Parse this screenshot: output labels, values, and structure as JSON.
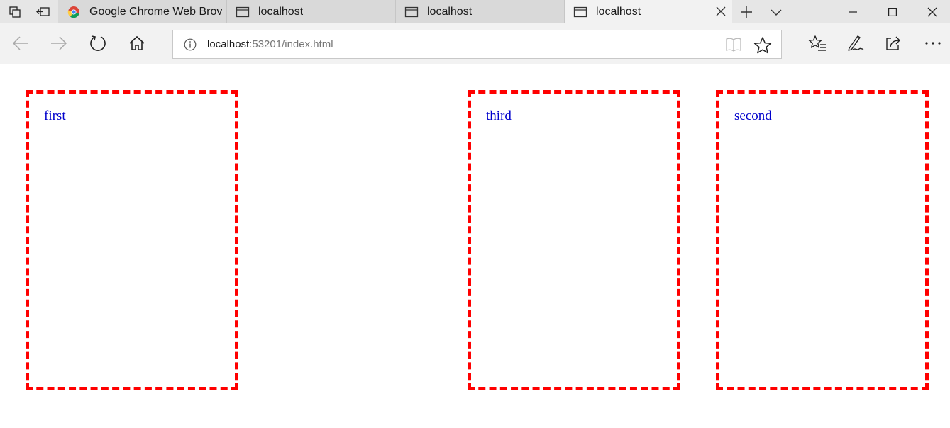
{
  "tabs": [
    {
      "label": "Google Chrome Web Brov",
      "icon": "chrome-icon",
      "active": false
    },
    {
      "label": "localhost",
      "icon": "page-icon",
      "active": false
    },
    {
      "label": "localhost",
      "icon": "page-icon",
      "active": false
    },
    {
      "label": "localhost",
      "icon": "page-icon",
      "active": true
    }
  ],
  "address": {
    "host": "localhost",
    "rest": ":53201/index.html"
  },
  "boxes": [
    {
      "label": "first"
    },
    {
      "label": "third"
    },
    {
      "label": "second"
    }
  ],
  "colors": {
    "box_border": "#ff0000",
    "box_text": "#0000cc"
  }
}
